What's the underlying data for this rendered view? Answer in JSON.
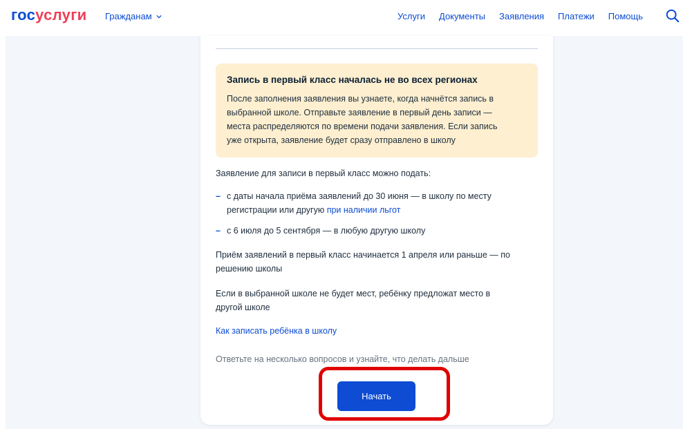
{
  "header": {
    "logo_part1": "гос",
    "logo_part2": "услуги",
    "citizens_label": "Гражданам",
    "nav": [
      "Услуги",
      "Документы",
      "Заявления",
      "Платежи",
      "Помощь"
    ]
  },
  "notice": {
    "title": "Запись в первый класс началась не во всех регионах",
    "lines": [
      "После заполнения заявления вы узнаете, когда начнётся запись в",
      "выбранной школе. Отправьте заявление в первый день записи —",
      "места распределяются по времени подачи заявления. Если запись",
      "уже открыта, заявление будет сразу отправлено в школу"
    ]
  },
  "content": {
    "intro": "Заявление для записи в первый класс можно подать:",
    "item1_line1": "с даты начала приёма заявлений до 30 июня — в школу по месту",
    "item1_line2_prefix": "регистрации или другую",
    "item1_link": "при наличии льгот",
    "item2": "с 6 июля до 5 сентября — в любую другую школу",
    "para1_line1": "Приём заявлений в первый класс начинается 1 апреля или раньше — по",
    "para1_line2": "решению школы",
    "para2_line1": "Если в выбранной школе не будет мест, ребёнку предложат место в",
    "para2_line2": "другой школе",
    "howto_link": "Как записать ребёнка в школу",
    "hint": "Ответьте на несколько вопросов и узнайте, что делать дальше",
    "start_button": "Начать"
  },
  "colors": {
    "brand_blue": "#0d4cd3",
    "brand_red": "#ee3f58",
    "notice_bg": "#fdefd0",
    "highlight": "#e00000"
  }
}
